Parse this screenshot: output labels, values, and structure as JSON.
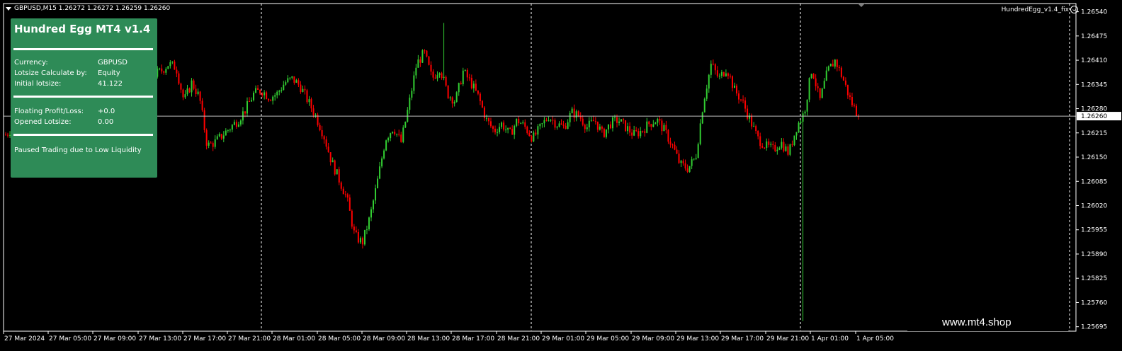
{
  "header": {
    "symbol_info": "GBPUSD,M15  1.26272 1.26272 1.26259 1.26260",
    "indicator_name": "HundredEgg_v1.4_fix"
  },
  "panel": {
    "title": "Hundred Egg MT4 v1.4",
    "rows1": [
      {
        "label": "Currency:",
        "value": "GBPUSD"
      },
      {
        "label": "Lotsize Calculate by:",
        "value": "Equity"
      },
      {
        "label": "Initial lotsize:",
        "value": "41.122"
      }
    ],
    "rows2": [
      {
        "label": "Floating Profit/Loss:",
        "value": "+0.0"
      },
      {
        "label": "Opened Lotsize:",
        "value": "0.00"
      }
    ],
    "status": "Paused Trading due to Low Liquidity"
  },
  "watermark": "www.mt4.shop",
  "colors": {
    "background": "#000000",
    "bull": "#32cd32",
    "bear": "#ff0000",
    "panel": "#2e8b57",
    "grid": "#ffffff"
  },
  "chart_data": {
    "type": "candlestick",
    "symbol": "GBPUSD",
    "timeframe": "M15",
    "current_price": 1.2626,
    "price_labels": [
      "1.26540",
      "1.26475",
      "1.26410",
      "1.26345",
      "1.26280",
      "1.26215",
      "1.26150",
      "1.26085",
      "1.26020",
      "1.25955",
      "1.25890",
      "1.25825",
      "1.25760",
      "1.25695"
    ],
    "current_price_label": "1.26260",
    "time_labels": [
      "27 Mar 2024",
      "27 Mar 05:00",
      "27 Mar 09:00",
      "27 Mar 13:00",
      "27 Mar 17:00",
      "27 Mar 21:00",
      "28 Mar 01:00",
      "28 Mar 05:00",
      "28 Mar 09:00",
      "28 Mar 13:00",
      "28 Mar 17:00",
      "28 Mar 21:00",
      "29 Mar 01:00",
      "29 Mar 05:00",
      "29 Mar 09:00",
      "29 Mar 13:00",
      "29 Mar 17:00",
      "29 Mar 21:00",
      "1 Apr 01:00",
      "1 Apr 05:00"
    ],
    "period_separators": [
      "28 Mar",
      "29 Mar",
      "1 Apr"
    ],
    "ylim": [
      1.25683,
      1.26562
    ],
    "close_path": [
      1.2621,
      1.2623,
      1.2619,
      1.2615,
      1.2616,
      1.2614,
      1.2617,
      1.2618,
      1.262,
      1.2623,
      1.2626,
      1.2629,
      1.2627,
      1.2625,
      1.2628,
      1.263,
      1.2629,
      1.2632,
      1.2635,
      1.2637,
      1.2638,
      1.264,
      1.2639,
      1.263,
      1.2635,
      1.2631,
      1.2618,
      1.2619,
      1.2621,
      1.2623,
      1.2625,
      1.2628,
      1.2632,
      1.2633,
      1.2631,
      1.2632,
      1.2635,
      1.2636,
      1.2634,
      1.263,
      1.2626,
      1.2621,
      1.2614,
      1.2609,
      1.2604,
      1.2594,
      1.2592,
      1.2599,
      1.2609,
      1.262,
      1.2623,
      1.2619,
      1.2629,
      1.264,
      1.2643,
      1.2636,
      1.2639,
      1.2632,
      1.263,
      1.2638,
      1.2635,
      1.2631,
      1.2625,
      1.2622,
      1.2624,
      1.2621,
      1.2625,
      1.2623,
      1.262,
      1.2623,
      1.2626,
      1.2624,
      1.2623,
      1.2627,
      1.2626,
      1.2623,
      1.2625,
      1.2621,
      1.2624,
      1.2625,
      1.2623,
      1.2621,
      1.2622,
      1.2624,
      1.2625,
      1.2622,
      1.2618,
      1.2613,
      1.2612,
      1.2615,
      1.263,
      1.264,
      1.2636,
      1.2639,
      1.2633,
      1.263,
      1.2625,
      1.262,
      1.2618,
      1.2617,
      1.2619,
      1.2616,
      1.2623,
      1.2627,
      1.2639,
      1.263,
      1.2638,
      1.2641,
      1.2636,
      1.263,
      1.2626
    ]
  }
}
